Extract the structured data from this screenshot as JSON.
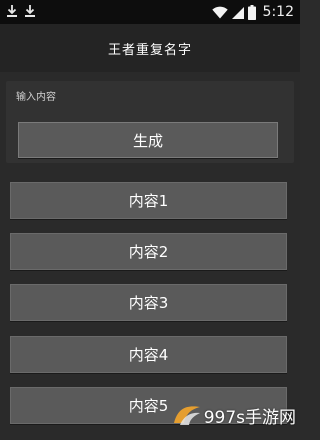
{
  "status_bar": {
    "time": "5:12",
    "icons": [
      "download-icon",
      "download-icon",
      "wifi-icon",
      "cellular-signal-icon",
      "battery-icon"
    ]
  },
  "app_bar": {
    "title": "王者重复名字"
  },
  "form": {
    "input_placeholder": "输入内容",
    "input_value": "",
    "generate_label": "生成"
  },
  "results": [
    "内容1",
    "内容2",
    "内容3",
    "内容4",
    "内容5"
  ],
  "watermark": {
    "text": "997s手游网",
    "icon": "watermark-logo-icon"
  },
  "colors": {
    "background": "#2a2a2a",
    "status_bar": "#0d0d0d",
    "button": "#5a5a5a"
  }
}
